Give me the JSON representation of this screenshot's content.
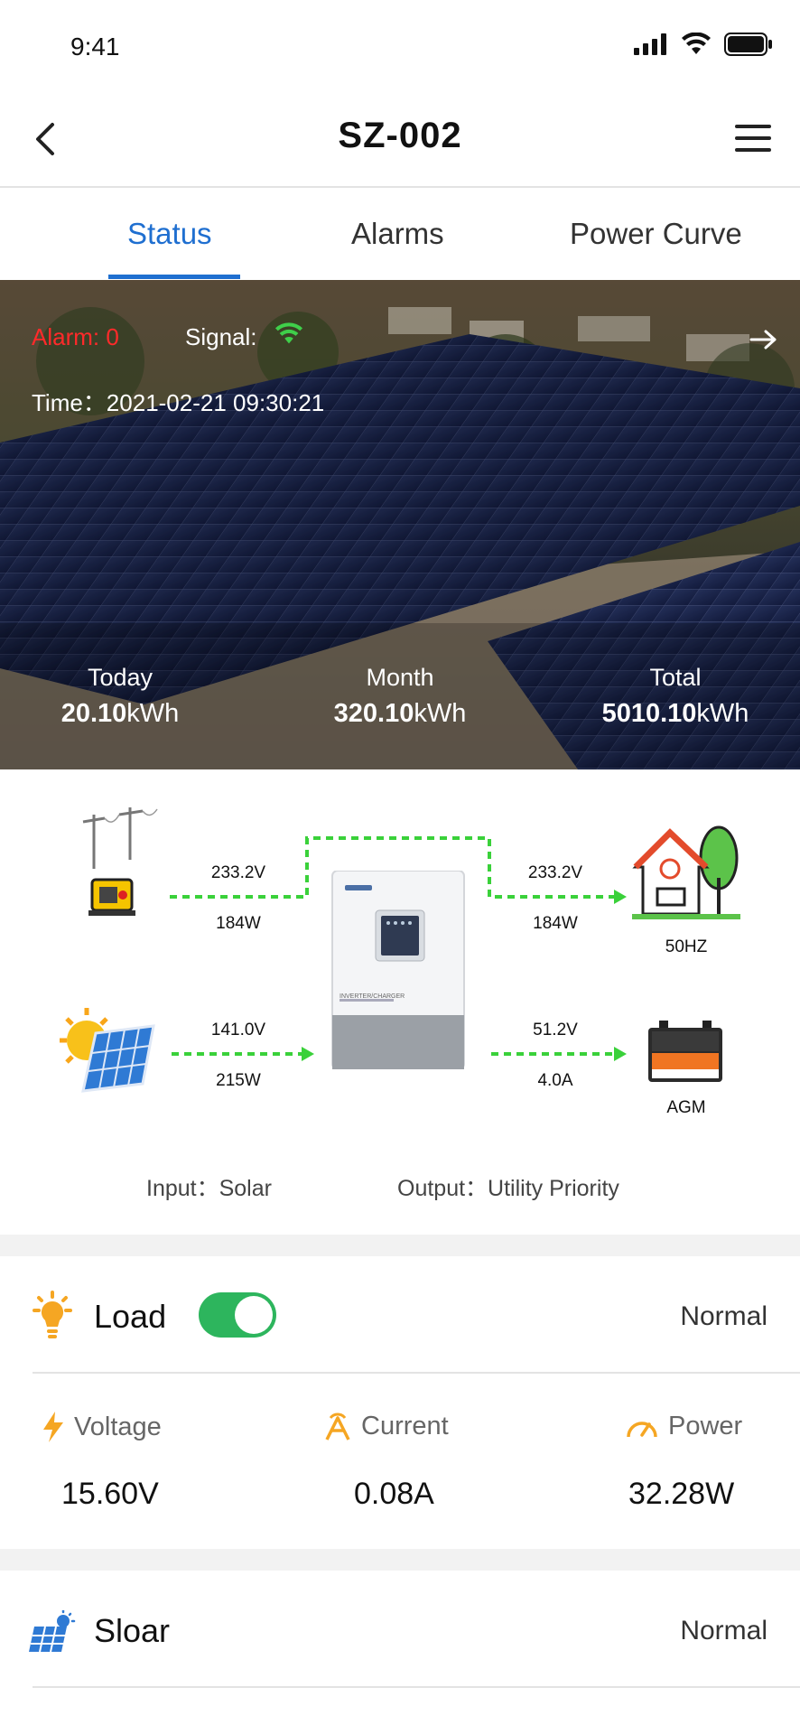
{
  "status_bar": {
    "time": "9:41"
  },
  "header": {
    "title": "SZ-002"
  },
  "tabs": [
    {
      "label": "Status",
      "active": true
    },
    {
      "label": "Alarms",
      "active": false
    },
    {
      "label": "Power Curve",
      "active": false
    }
  ],
  "hero": {
    "alarm_text": "Alarm: 0",
    "signal_label": "Signal:",
    "time_text": "Time：2021-02-21 09:30:21",
    "stats": [
      {
        "label": "Today",
        "value": "20.10",
        "unit": "kWh"
      },
      {
        "label": "Month",
        "value": "320.10",
        "unit": "kWh"
      },
      {
        "label": "Total",
        "value": "5010.10",
        "unit": "kWh"
      }
    ]
  },
  "flow": {
    "grid_in": {
      "voltage": "233.2V",
      "power": "184W"
    },
    "house_out": {
      "voltage": "233.2V",
      "power": "184W",
      "label": "50HZ"
    },
    "solar_in": {
      "voltage": "141.0V",
      "power": "215W"
    },
    "battery_out": {
      "voltage": "51.2V",
      "current": "4.0A",
      "label": "AGM"
    },
    "inverter_label": "INVERTER/CHARGER",
    "input_mode": "Input：Solar",
    "output_mode": "Output：Utility Priority",
    "line_color": "#3ad13a"
  },
  "load": {
    "title": "Load",
    "status": "Normal",
    "toggle_on": true,
    "metrics": [
      {
        "label": "Voltage",
        "value": "15.60V",
        "icon": "bolt-icon"
      },
      {
        "label": "Current",
        "value": "0.08A",
        "icon": "current-icon"
      },
      {
        "label": "Power",
        "value": "32.28W",
        "icon": "gauge-icon"
      }
    ]
  },
  "solar": {
    "title": "Sloar",
    "status": "Normal"
  },
  "colors": {
    "accent": "#1f6fd0",
    "alarm": "#ff2a2a",
    "toggle": "#2db55d",
    "orange": "#f5a623"
  }
}
